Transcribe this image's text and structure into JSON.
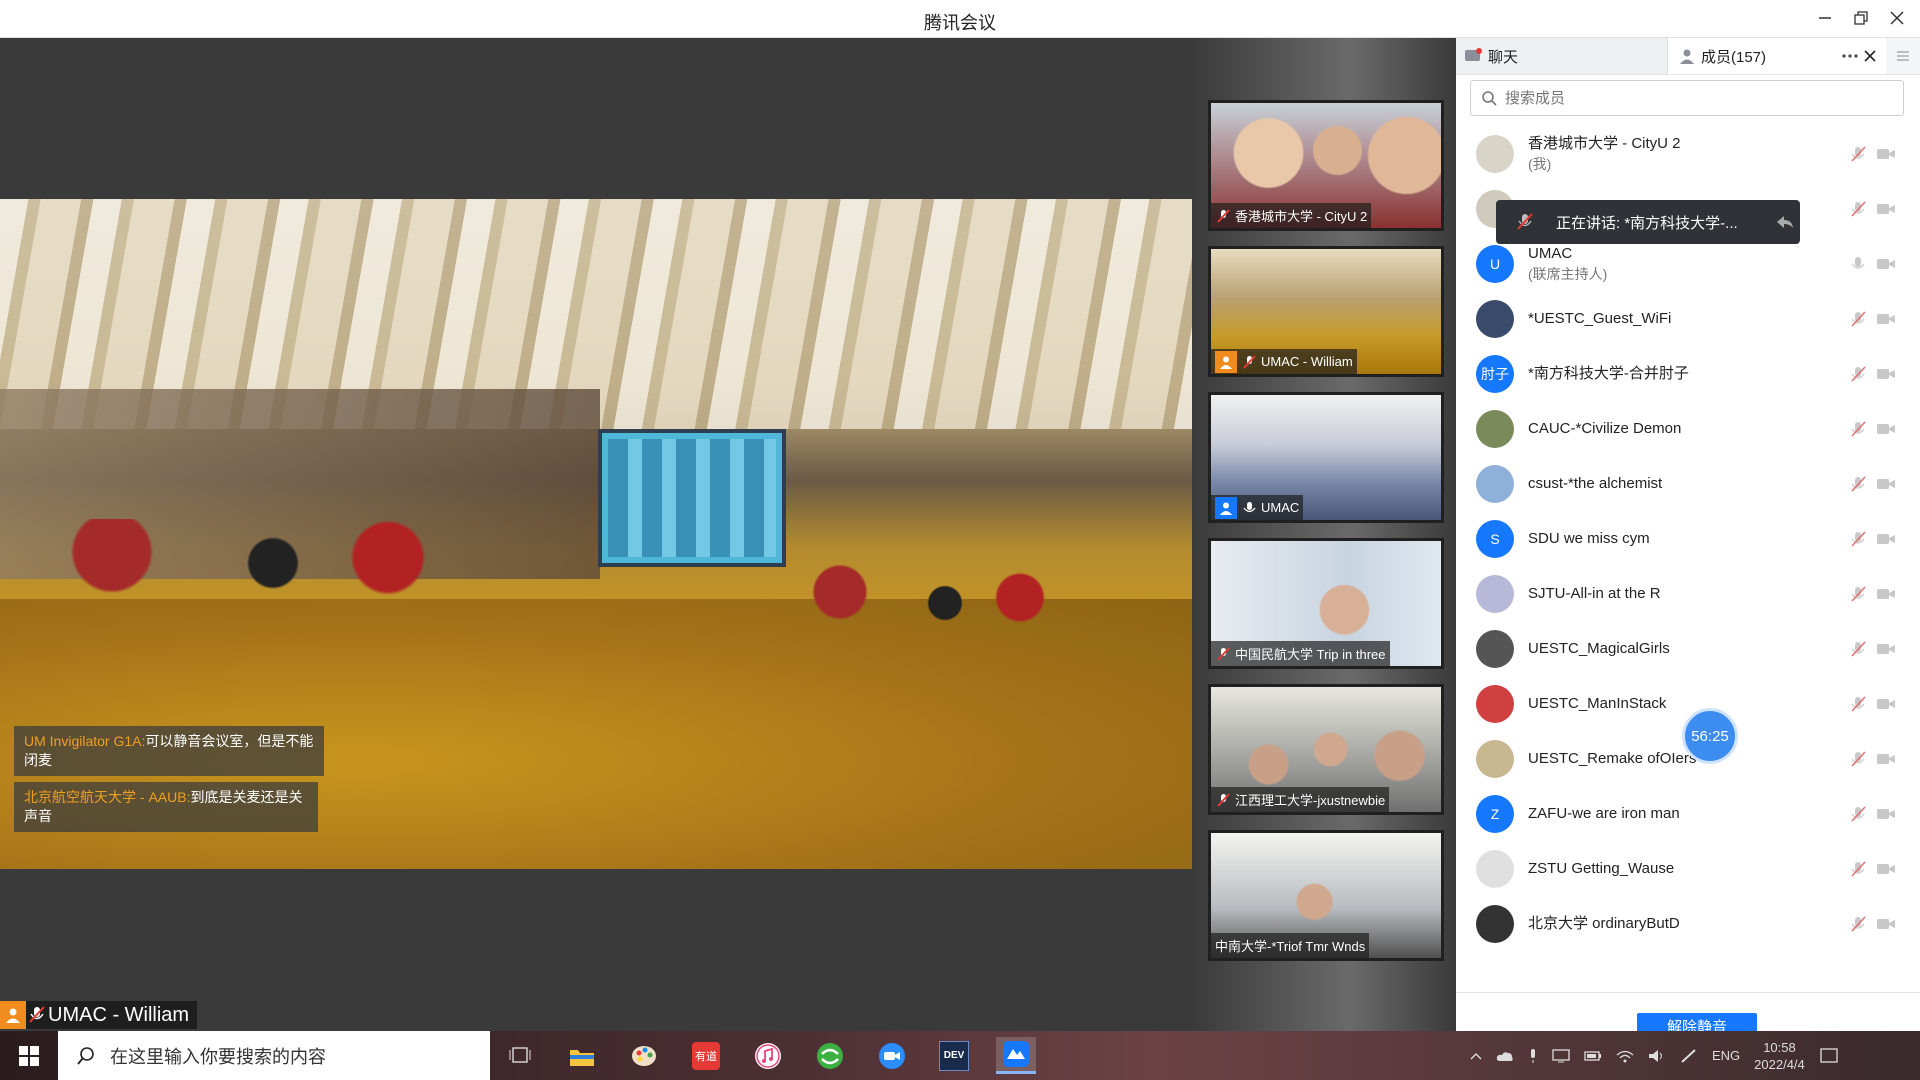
{
  "app": {
    "title": "腾讯会议"
  },
  "main": {
    "speaker_name": "UMAC - William",
    "chat_messages": [
      {
        "author": "UM Invigilator G1A:",
        "text": "可以静音会议室，但是不能闭麦"
      },
      {
        "author": "北京航空航天大学 - AAUB:",
        "text": "到底是关麦还是关声音"
      }
    ]
  },
  "thumbnails": [
    {
      "label": "香港城市大学 - CityU 2",
      "mic": "muted",
      "avatar": ""
    },
    {
      "label": "UMAC - William",
      "mic": "muted",
      "avatar": "person-orange"
    },
    {
      "label": "UMAC",
      "mic": "on",
      "avatar": "person-blue"
    },
    {
      "label": "中国民航大学 Trip in three",
      "mic": "muted",
      "avatar": ""
    },
    {
      "label": "江西理工大学-jxustnewbie",
      "mic": "muted",
      "avatar": ""
    },
    {
      "label": "中南大学-*Triof Tmr Wnds",
      "mic": "none",
      "avatar": ""
    }
  ],
  "panel": {
    "tab_chat": "聊天",
    "tab_members": "成员(157)",
    "search_placeholder": "搜索成员",
    "speaking_popup": "正在讲话: *南方科技大学-...",
    "timer": "56:25",
    "unmute_button": "解除静音",
    "members": [
      {
        "name": "香港城市大学 - CityU 2",
        "sub": "(我)",
        "avatar_text": "",
        "avatar_color": "#d9d4c8"
      },
      {
        "name": "",
        "sub": "",
        "avatar_text": "",
        "avatar_color": "#cfcabb"
      },
      {
        "name": "UMAC",
        "sub": "(联席主持人)",
        "avatar_text": "U",
        "avatar_color": "#1677ff"
      },
      {
        "name": "*UESTC_Guest_WiFi",
        "sub": "",
        "avatar_text": "",
        "avatar_color": "#3a4a6b"
      },
      {
        "name": "*南方科技大学-合并肘子",
        "sub": "",
        "avatar_text": "肘子",
        "avatar_color": "#1677ff"
      },
      {
        "name": "CAUC-*Civilize Demon",
        "sub": "",
        "avatar_text": "",
        "avatar_color": "#7a8a5a"
      },
      {
        "name": "csust-*the alchemist",
        "sub": "",
        "avatar_text": "",
        "avatar_color": "#8fb0d8"
      },
      {
        "name": "SDU we miss cym",
        "sub": "",
        "avatar_text": "S",
        "avatar_color": "#1677ff"
      },
      {
        "name": "SJTU-All-in at the R",
        "sub": "",
        "avatar_text": "",
        "avatar_color": "#b8b8d8"
      },
      {
        "name": "UESTC_MagicalGirls",
        "sub": "",
        "avatar_text": "",
        "avatar_color": "#555"
      },
      {
        "name": "UESTC_ManInStack",
        "sub": "",
        "avatar_text": "",
        "avatar_color": "#d04040"
      },
      {
        "name": "UESTC_Remake ofOIers",
        "sub": "",
        "avatar_text": "",
        "avatar_color": "#c8b890"
      },
      {
        "name": "ZAFU-we are iron man",
        "sub": "",
        "avatar_text": "Z",
        "avatar_color": "#1677ff"
      },
      {
        "name": "ZSTU Getting_Wause",
        "sub": "",
        "avatar_text": "",
        "avatar_color": "#e0e0e0"
      },
      {
        "name": "北京大学 ordinaryButD",
        "sub": "",
        "avatar_text": "",
        "avatar_color": "#333"
      }
    ]
  },
  "taskbar": {
    "search_placeholder": "在这里输入你要搜索的内容",
    "apps": [
      "task-view",
      "file-explorer",
      "paint",
      "youdao",
      "itunes",
      "browser",
      "zoom",
      "devcpp",
      "tencent-meeting"
    ],
    "youdao_label": "有道",
    "dev_label": "DEV",
    "lang": "ENG",
    "time": "10:58",
    "date": "2022/4/4"
  }
}
